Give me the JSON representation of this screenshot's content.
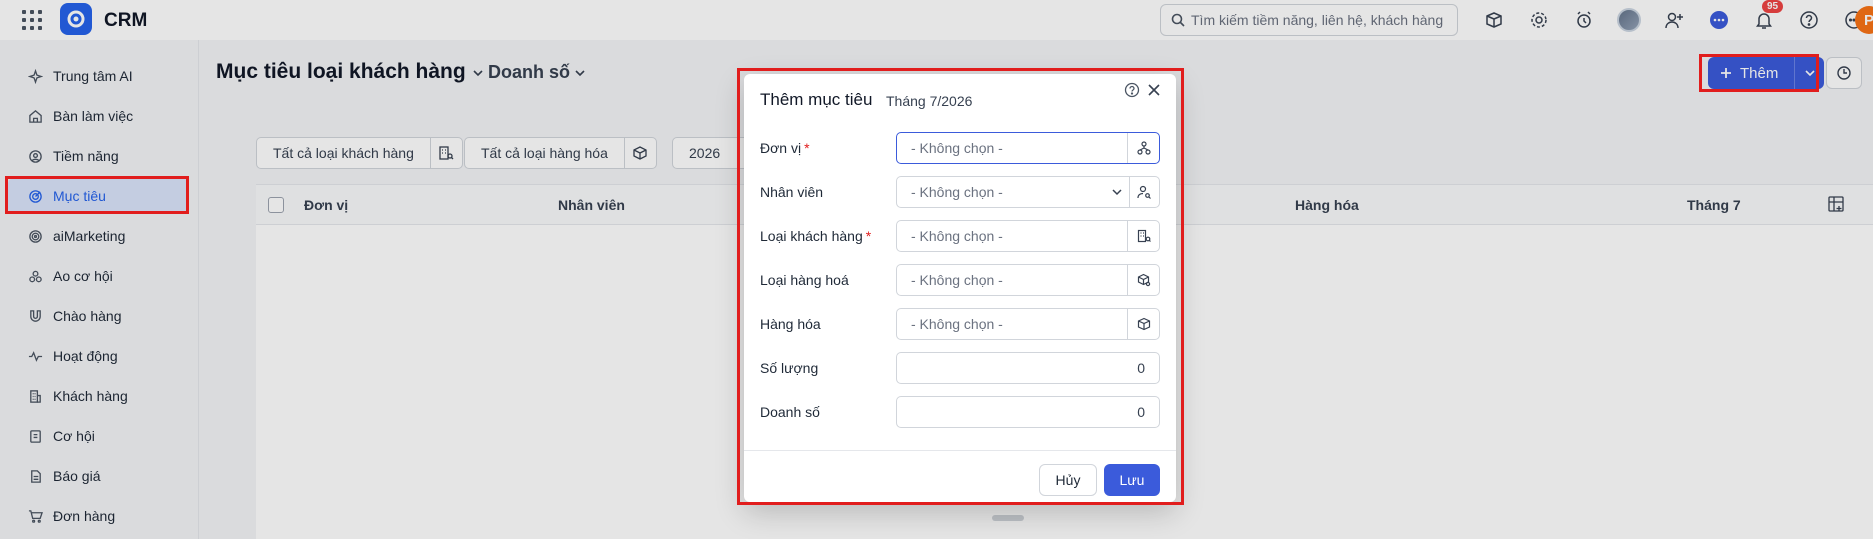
{
  "app": {
    "title": "CRM"
  },
  "search": {
    "placeholder": "Tìm kiếm tiềm năng, liên hệ, khách hàng"
  },
  "notifications": {
    "count": "95"
  },
  "user": {
    "initial": "P"
  },
  "sidebar": {
    "items": [
      {
        "label": "Trung tâm AI",
        "icon": "sparkle-icon"
      },
      {
        "label": "Bàn làm việc",
        "icon": "home-icon"
      },
      {
        "label": "Tiềm năng",
        "icon": "target-user-icon"
      },
      {
        "label": "Mục tiêu",
        "icon": "goal-icon",
        "active": true
      },
      {
        "label": "aiMarketing",
        "icon": "marketing-icon"
      },
      {
        "label": "Ao cơ hội",
        "icon": "pool-icon"
      },
      {
        "label": "Chào hàng",
        "icon": "magnet-icon"
      },
      {
        "label": "Hoạt động",
        "icon": "activity-icon"
      },
      {
        "label": "Khách hàng",
        "icon": "building-icon"
      },
      {
        "label": "Cơ hội",
        "icon": "opportunity-icon"
      },
      {
        "label": "Báo giá",
        "icon": "quote-icon"
      },
      {
        "label": "Đơn hàng",
        "icon": "cart-icon"
      }
    ]
  },
  "page": {
    "title": "Mục tiêu loại khách hàng",
    "view": "Doanh số",
    "add_label": "Thêm"
  },
  "filters": {
    "customer_type": "Tất cả loại khách hàng",
    "product_type": "Tất cả loại hàng hóa",
    "year": "2026"
  },
  "table": {
    "columns": [
      "Đơn vị",
      "Nhân viên",
      "Hàng hóa",
      "Tháng 7"
    ]
  },
  "modal": {
    "title": "Thêm mục tiêu",
    "subtitle": "Tháng 7/2026",
    "fields": [
      {
        "label": "Đơn vị",
        "required": true,
        "placeholder": "- Không chọn -",
        "icon": "org-tree-icon"
      },
      {
        "label": "Nhân viên",
        "required": false,
        "placeholder": "- Không chọn -",
        "icon": "user-search-icon"
      },
      {
        "label": "Loại khách hàng",
        "required": true,
        "placeholder": "- Không chọn -",
        "icon": "building-search-icon"
      },
      {
        "label": "Loại hàng hoá",
        "required": false,
        "placeholder": "- Không chọn -",
        "icon": "box-search-icon"
      },
      {
        "label": "Hàng hóa",
        "required": false,
        "placeholder": "- Không chọn -",
        "icon": "box-icon"
      },
      {
        "label": "Số lượng",
        "required": false,
        "value": "0"
      },
      {
        "label": "Doanh số",
        "required": false,
        "value": "0"
      }
    ],
    "cancel_label": "Hủy",
    "save_label": "Lưu"
  },
  "colors": {
    "accent": "#3b5bdb",
    "highlight": "#e11d1d",
    "required": "#e11d1d"
  }
}
